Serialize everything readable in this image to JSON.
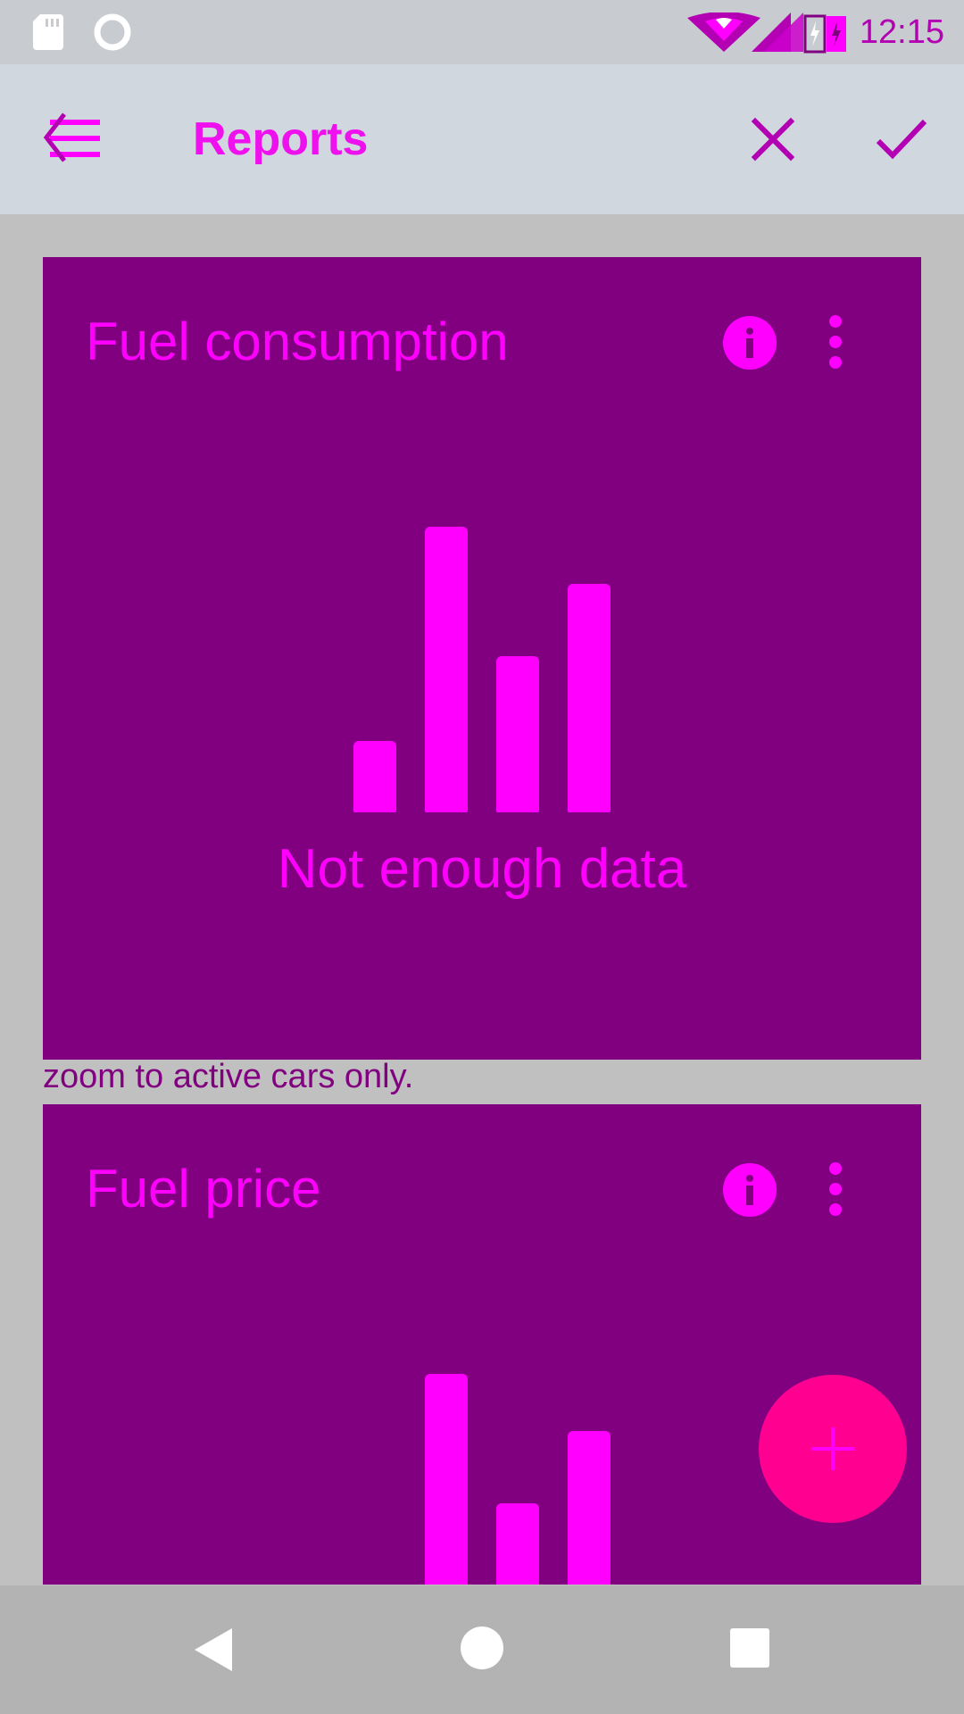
{
  "status_bar": {
    "time": "12:15",
    "icons": [
      "sd-card-icon",
      "ring-icon",
      "wifi-icon",
      "cell-signal-icon",
      "battery-charging-icon"
    ]
  },
  "app_bar": {
    "title": "Reports",
    "icons": [
      "filter-menu-icon",
      "close-icon",
      "check-icon"
    ]
  },
  "cards": [
    {
      "title": "Fuel consumption",
      "empty_text": "Not enough data",
      "icons": [
        "info-icon",
        "more-vert-icon",
        "bar-chart-icon"
      ]
    },
    {
      "title": "Fuel price",
      "icons": [
        "info-icon",
        "more-vert-icon",
        "bar-chart-icon"
      ]
    }
  ],
  "hint_text": "zoom to active cars only.",
  "fab": {
    "icon": "plus-icon"
  },
  "nav_bar": {
    "icons": [
      "back-icon",
      "home-icon",
      "recents-icon"
    ]
  },
  "colors": {
    "card_bg": "#800080",
    "accent": "#ff00ff",
    "fab": "#ff0090",
    "app_bar_bg": "#d0d7de",
    "status_bar_bg": "#c8cbcf",
    "nav_bar_bg": "#b3b3b3",
    "page_bg": "#c0c0c0"
  }
}
